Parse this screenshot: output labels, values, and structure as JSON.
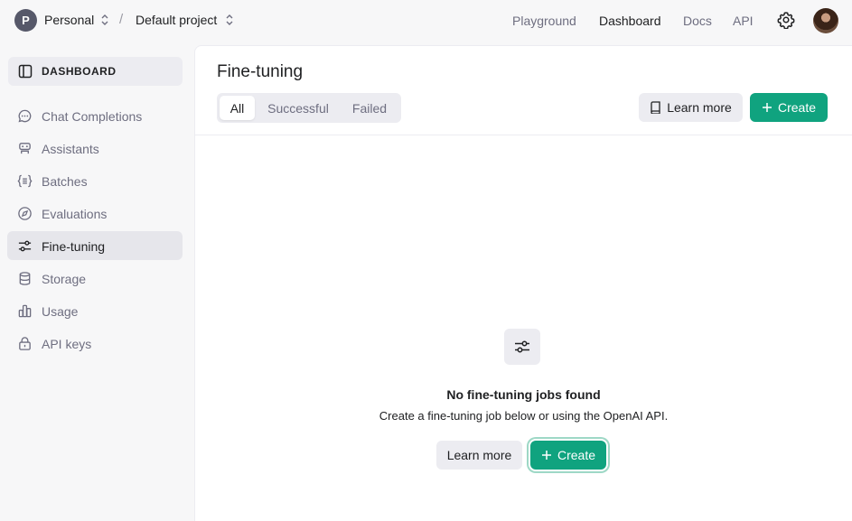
{
  "topbar": {
    "org_initial": "P",
    "org_name": "Personal",
    "separator": "/",
    "project_name": "Default project",
    "nav": [
      "Playground",
      "Dashboard",
      "Docs",
      "API"
    ],
    "active_nav": "Dashboard"
  },
  "sidebar": {
    "header_label": "DASHBOARD",
    "items": [
      {
        "label": "Chat Completions",
        "icon": "chat-bubble-icon"
      },
      {
        "label": "Assistants",
        "icon": "robot-icon"
      },
      {
        "label": "Batches",
        "icon": "braces-list-icon"
      },
      {
        "label": "Evaluations",
        "icon": "compass-icon"
      },
      {
        "label": "Fine-tuning",
        "icon": "sliders-icon"
      },
      {
        "label": "Storage",
        "icon": "database-icon"
      },
      {
        "label": "Usage",
        "icon": "bar-chart-icon"
      },
      {
        "label": "API keys",
        "icon": "lock-icon"
      }
    ],
    "active_item": "Fine-tuning"
  },
  "main": {
    "title": "Fine-tuning",
    "tabs": [
      "All",
      "Successful",
      "Failed"
    ],
    "active_tab": "All",
    "learn_more_label": "Learn more",
    "create_label": "Create",
    "empty": {
      "title": "No fine-tuning jobs found",
      "subtitle": "Create a fine-tuning job below or using the OpenAI API.",
      "learn_more_label": "Learn more",
      "create_label": "Create"
    }
  },
  "colors": {
    "accent": "#10a37f",
    "sidebar_bg": "#f7f7f8",
    "muted_text": "#6e6e80"
  }
}
